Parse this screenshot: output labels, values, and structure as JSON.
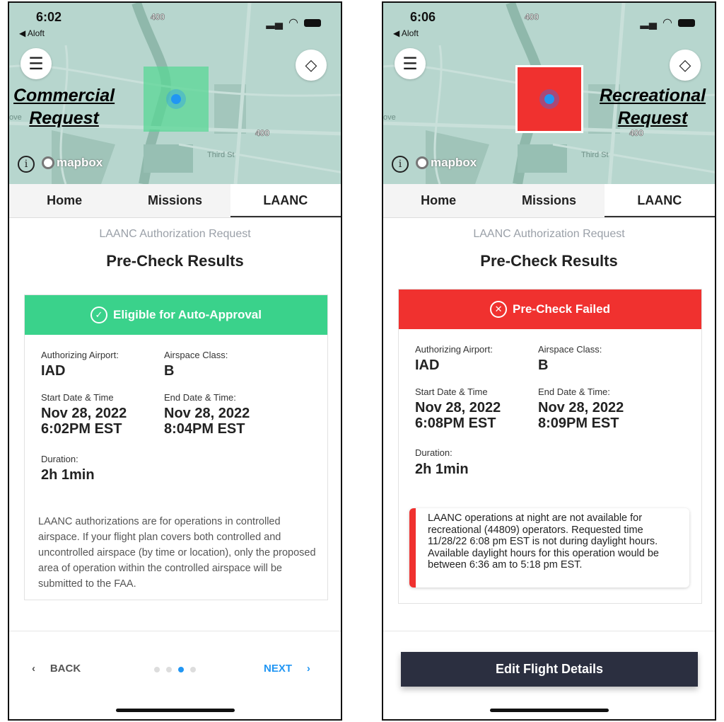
{
  "colors": {
    "approved": "#3ad28b",
    "failed": "#f0312f",
    "accent": "#2196f3",
    "button": "#2b2f40"
  },
  "common": {
    "back_app": "◀ Aloft",
    "tabs": [
      "Home",
      "Missions",
      "LAANC"
    ],
    "subtitle": "LAANC Authorization Request",
    "title": "Pre-Check Results",
    "mapbox": "mapbox",
    "labels": {
      "airport": "Authorizing Airport:",
      "class": "Airspace Class:",
      "start": "Start Date & Time",
      "end": "End Date & Time:",
      "duration": "Duration:"
    }
  },
  "left": {
    "time": "6:02",
    "overlay_label": [
      "Commercial",
      "Request"
    ],
    "banner": "Eligible for Auto-Approval",
    "airport": "IAD",
    "class": "B",
    "start": [
      "Nov 28, 2022",
      "6:02PM EST"
    ],
    "end": [
      "Nov 28, 2022",
      "8:04PM EST"
    ],
    "duration": "2h 1min",
    "note": "LAANC authorizations are for operations in controlled airspace. If your flight plan covers both controlled and uncontrolled airspace (by time or location), only the proposed area of operation within the controlled airspace will be submitted to the FAA.",
    "back": "BACK",
    "next": "NEXT",
    "page": 3,
    "pages": 4
  },
  "right": {
    "time": "6:06",
    "overlay_label": [
      "Recreational",
      "Request"
    ],
    "banner": "Pre-Check Failed",
    "airport": "IAD",
    "class": "B",
    "start": [
      "Nov 28, 2022",
      "6:08PM EST"
    ],
    "end": [
      "Nov 28, 2022",
      "8:09PM EST"
    ],
    "duration": "2h 1min",
    "alert": "LAANC operations at night are not available for recreational (44809) operators. Requested time 11/28/22 6:08 pm EST is not during daylight hours. Available daylight hours for this operation would be between 6:36 am to 5:18 pm EST.",
    "button": "Edit Flight Details"
  }
}
